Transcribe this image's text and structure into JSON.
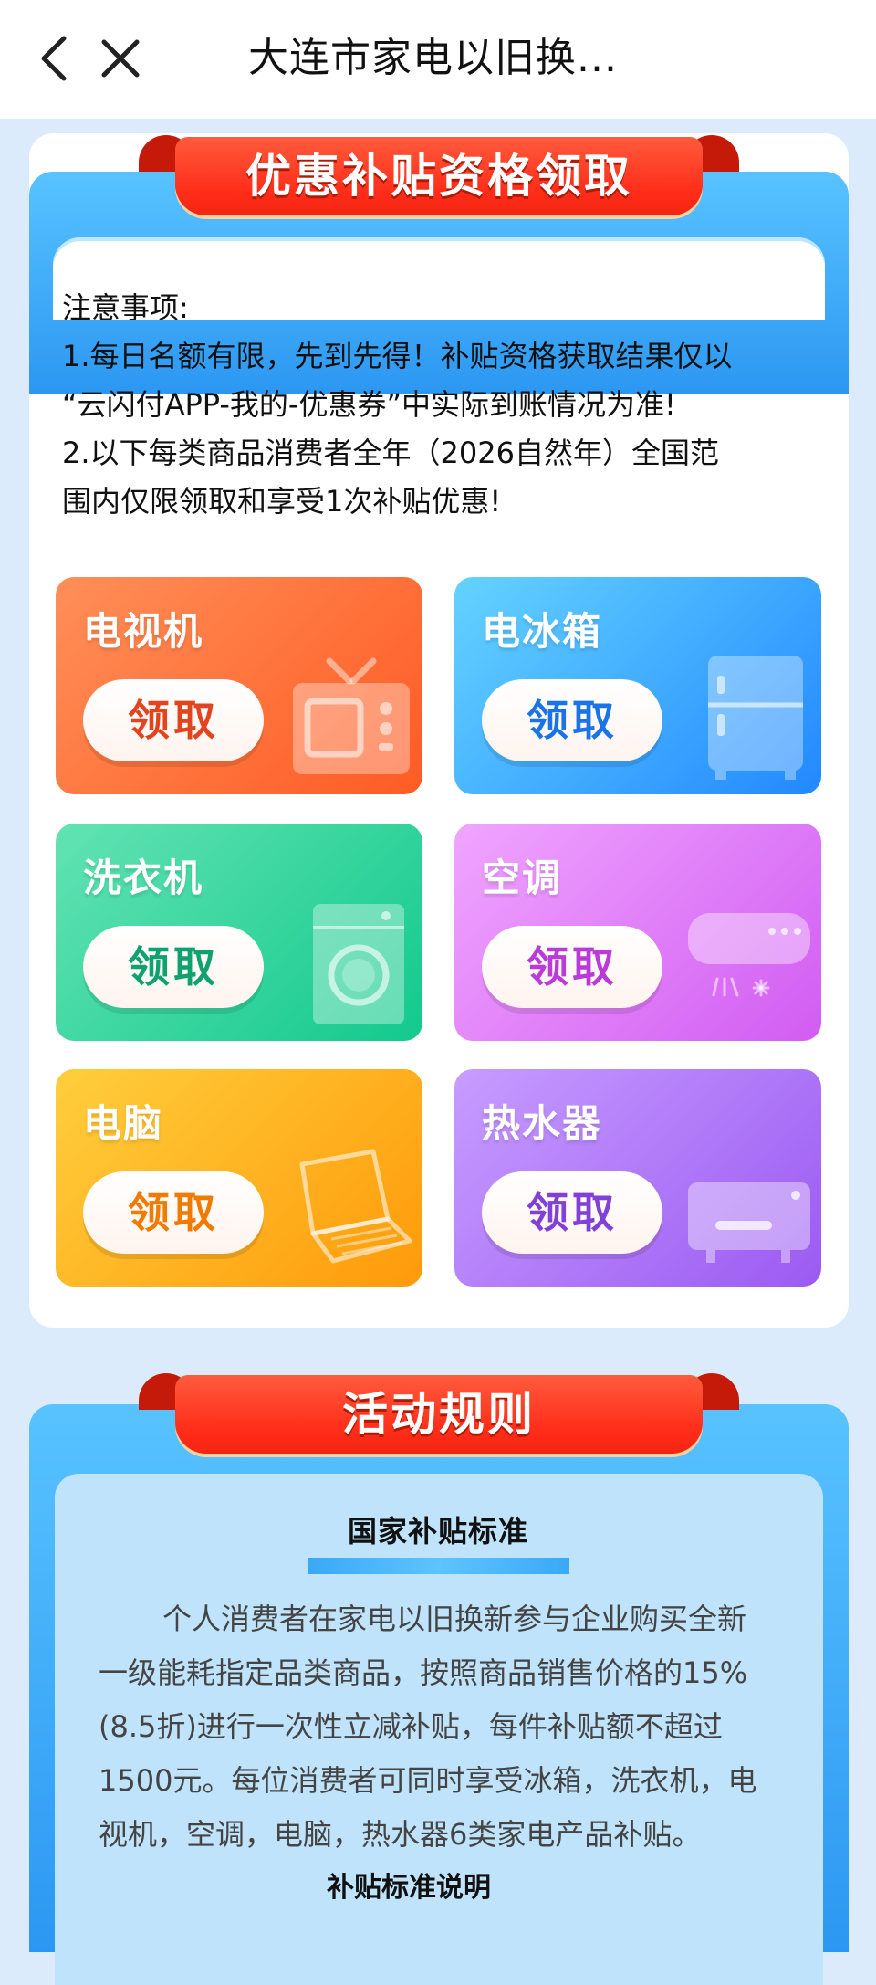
{
  "header": {
    "title": "大连市家电以旧换..."
  },
  "eligibility_card": {
    "ribbon_title": "优惠补贴资格领取",
    "notice_lines": [
      "注意事项:",
      "1.每日名额有限，先到先得！补贴资格获取结果仅以",
      "“云闪付APP-我的-优惠券”中实际到账情况为准!",
      "2.以下每类商品消费者全年（2026自然年）全国范",
      "围内仅限领取和享受1次补贴优惠!"
    ],
    "categories": [
      {
        "label": "电视机",
        "button": "领取",
        "icon": "tv-icon"
      },
      {
        "label": "电冰箱",
        "button": "领取",
        "icon": "fridge-icon"
      },
      {
        "label": "洗衣机",
        "button": "领取",
        "icon": "washer-icon"
      },
      {
        "label": "空调",
        "button": "领取",
        "icon": "air-conditioner-icon"
      },
      {
        "label": "电脑",
        "button": "领取",
        "icon": "laptop-icon"
      },
      {
        "label": "热水器",
        "button": "领取",
        "icon": "water-heater-icon"
      }
    ]
  },
  "rules_card": {
    "ribbon_title": "活动规则",
    "section_title": "国家补贴标准",
    "paragraph_lines": [
      "个人消费者在家电以旧换新参与企业购买全新",
      "一级能耗指定品类商品，按照商品销售价格的15%",
      "(8.5折)进行一次性立减补贴，每件补贴额不超过",
      "1500元。每位消费者可同时享受冰箱，洗衣机，电",
      "视机，空调，电脑，热水器6类家电产品补贴。"
    ],
    "next_heading": "补贴标准说明"
  },
  "colors": {
    "ribbon_red": "#ff2d1a",
    "card_blue": "#2c97f2",
    "page_bg": "#dcebfb"
  }
}
